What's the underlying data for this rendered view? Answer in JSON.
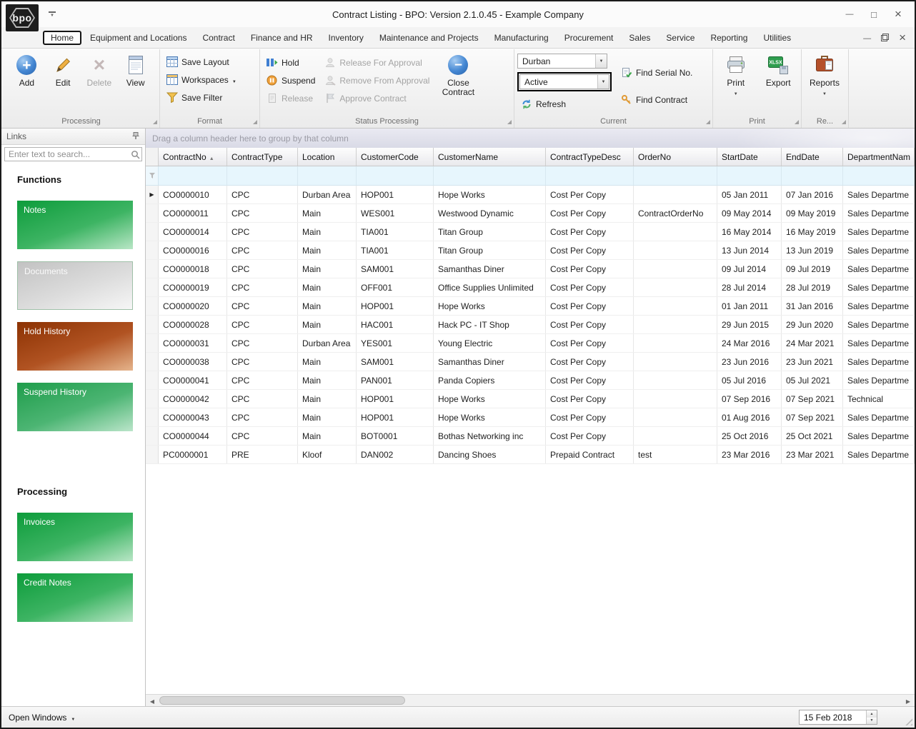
{
  "titlebar": {
    "logo": "bpo",
    "title": "Contract Listing - BPO: Version 2.1.0.45 - Example Company"
  },
  "tabs": [
    {
      "label": "Home",
      "state": "active"
    },
    {
      "label": "Equipment and Locations"
    },
    {
      "label": "Contract"
    },
    {
      "label": "Finance and HR"
    },
    {
      "label": "Inventory"
    },
    {
      "label": "Maintenance and Projects"
    },
    {
      "label": "Manufacturing"
    },
    {
      "label": "Procurement"
    },
    {
      "label": "Sales"
    },
    {
      "label": "Service"
    },
    {
      "label": "Reporting"
    },
    {
      "label": "Utilities"
    }
  ],
  "ribbon": {
    "processing": {
      "label": "Processing",
      "add": "Add",
      "edit": "Edit",
      "delete": "Delete",
      "view": "View"
    },
    "format": {
      "label": "Format",
      "save_layout": "Save Layout",
      "workspaces": "Workspaces",
      "save_filter": "Save Filter"
    },
    "status_processing": {
      "label": "Status Processing",
      "hold": "Hold",
      "suspend": "Suspend",
      "release": "Release",
      "release_for_approval": "Release For Approval",
      "remove_from_approval": "Remove From Approval",
      "approve_contract": "Approve Contract",
      "close_contract": "Close Contract"
    },
    "current": {
      "label": "Current",
      "site_value": "Durban",
      "status_value": "Active",
      "refresh": "Refresh",
      "find_serial": "Find Serial No.",
      "find_contract": "Find Contract"
    },
    "print_group": {
      "label": "Print",
      "print": "Print",
      "export": "Export",
      "export_icon_text": "XLSX"
    },
    "reports_group": {
      "label": "Re...",
      "reports": "Reports"
    }
  },
  "sidebar": {
    "panel_title": "Links",
    "search_placeholder": "Enter text to search...",
    "functions_heading": "Functions",
    "functions_tiles": [
      {
        "label": "Notes",
        "color": "green"
      },
      {
        "label": "Documents",
        "color": "silver"
      },
      {
        "label": "Hold History",
        "color": "rust"
      },
      {
        "label": "Suspend History",
        "color": "green2"
      }
    ],
    "processing_heading": "Processing",
    "processing_tiles": [
      {
        "label": "Invoices",
        "color": "green"
      },
      {
        "label": "Credit Notes",
        "color": "green"
      }
    ]
  },
  "grid": {
    "group_hint": "Drag a column header here to group by that column",
    "columns": [
      "ContractNo",
      "ContractType",
      "Location",
      "CustomerCode",
      "CustomerName",
      "ContractTypeDesc",
      "OrderNo",
      "StartDate",
      "EndDate",
      "DepartmentNam"
    ],
    "rows": [
      {
        "state": "current",
        "cells": [
          "CO0000010",
          "CPC",
          "Durban Area",
          "HOP001",
          "Hope Works",
          "Cost Per Copy",
          "",
          "05 Jan 2011",
          "07 Jan 2016",
          "Sales Departme"
        ]
      },
      {
        "cells": [
          "CO0000011",
          "CPC",
          "Main",
          "WES001",
          "Westwood Dynamic",
          "Cost Per Copy",
          "ContractOrderNo",
          "09 May 2014",
          "09 May 2019",
          "Sales Departme"
        ]
      },
      {
        "cells": [
          "CO0000014",
          "CPC",
          "Main",
          "TIA001",
          "Titan Group",
          "Cost Per Copy",
          "",
          "16 May 2014",
          "16 May 2019",
          "Sales Departme"
        ]
      },
      {
        "cells": [
          "CO0000016",
          "CPC",
          "Main",
          "TIA001",
          "Titan Group",
          "Cost Per Copy",
          "",
          "13 Jun 2014",
          "13 Jun 2019",
          "Sales Departme"
        ]
      },
      {
        "cells": [
          "CO0000018",
          "CPC",
          "Main",
          "SAM001",
          "Samanthas Diner",
          "Cost Per Copy",
          "",
          "09 Jul 2014",
          "09 Jul 2019",
          "Sales Departme"
        ]
      },
      {
        "cells": [
          "CO0000019",
          "CPC",
          "Main",
          "OFF001",
          "Office Supplies Unlimited",
          "Cost Per Copy",
          "",
          "28 Jul 2014",
          "28 Jul 2019",
          "Sales Departme"
        ]
      },
      {
        "cells": [
          "CO0000020",
          "CPC",
          "Main",
          "HOP001",
          "Hope Works",
          "Cost Per Copy",
          "",
          "01 Jan 2011",
          "31 Jan 2016",
          "Sales Departme"
        ]
      },
      {
        "cells": [
          "CO0000028",
          "CPC",
          "Main",
          "HAC001",
          "Hack PC - IT Shop",
          "Cost Per Copy",
          "",
          "29 Jun 2015",
          "29 Jun 2020",
          "Sales Departme"
        ]
      },
      {
        "cells": [
          "CO0000031",
          "CPC",
          "Durban Area",
          "YES001",
          "Young Electric",
          "Cost Per Copy",
          "",
          "24 Mar 2016",
          "24 Mar 2021",
          "Sales Departme"
        ]
      },
      {
        "cells": [
          "CO0000038",
          "CPC",
          "Main",
          "SAM001",
          "Samanthas Diner",
          "Cost Per Copy",
          "",
          "23 Jun 2016",
          "23 Jun 2021",
          "Sales Departme"
        ]
      },
      {
        "cells": [
          "CO0000041",
          "CPC",
          "Main",
          "PAN001",
          "Panda Copiers",
          "Cost Per Copy",
          "",
          "05 Jul 2016",
          "05 Jul 2021",
          "Sales Departme"
        ]
      },
      {
        "cells": [
          "CO0000042",
          "CPC",
          "Main",
          "HOP001",
          "Hope Works",
          "Cost Per Copy",
          "",
          "07 Sep 2016",
          "07 Sep 2021",
          "Technical"
        ]
      },
      {
        "cells": [
          "CO0000043",
          "CPC",
          "Main",
          "HOP001",
          "Hope Works",
          "Cost Per Copy",
          "",
          "01 Aug 2016",
          "07 Sep 2021",
          "Sales Departme"
        ]
      },
      {
        "cells": [
          "CO0000044",
          "CPC",
          "Main",
          "BOT0001",
          "Bothas Networking inc",
          "Cost Per Copy",
          "",
          "25 Oct 2016",
          "25 Oct 2021",
          "Sales Departme"
        ]
      },
      {
        "cells": [
          "PC0000001",
          "PRE",
          "Kloof",
          "DAN002",
          "Dancing Shoes",
          "Prepaid Contract",
          "test",
          "23 Mar 2016",
          "23 Mar 2021",
          "Sales Departme"
        ]
      }
    ]
  },
  "statusbar": {
    "open_windows": "Open Windows",
    "date_value": "15 Feb 2018"
  }
}
